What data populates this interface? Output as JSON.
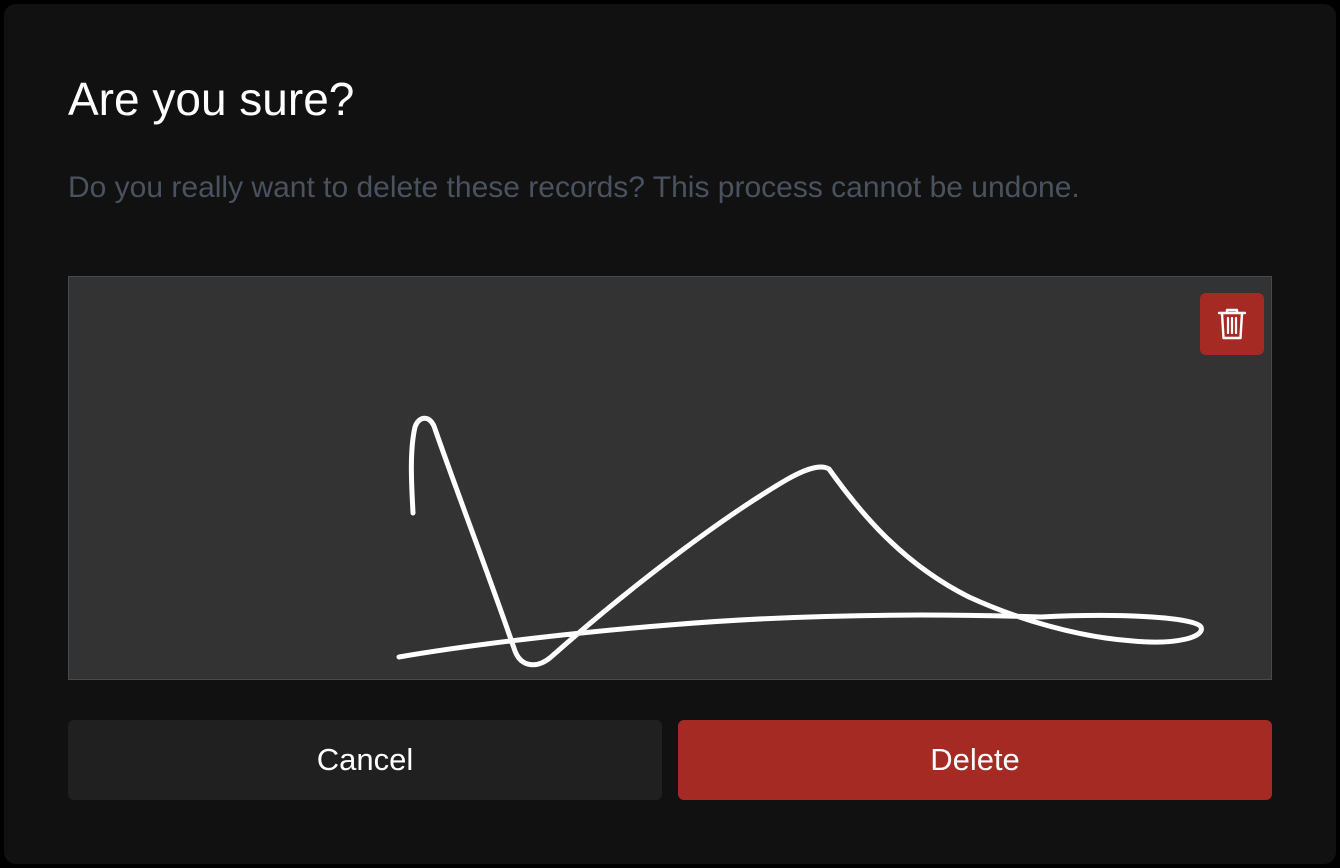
{
  "dialog": {
    "title": "Are you sure?",
    "message": "Do you really want to delete these records? This process cannot be undone."
  },
  "signature_pad": {
    "clear_icon": "trash-icon",
    "background_color": "#333333",
    "stroke_color": "#ffffff"
  },
  "actions": {
    "cancel_label": "Cancel",
    "delete_label": "Delete"
  },
  "colors": {
    "dialog_background": "#111111",
    "danger": "#a62a24",
    "secondary_button": "#202020",
    "muted_text": "#4a5260"
  }
}
